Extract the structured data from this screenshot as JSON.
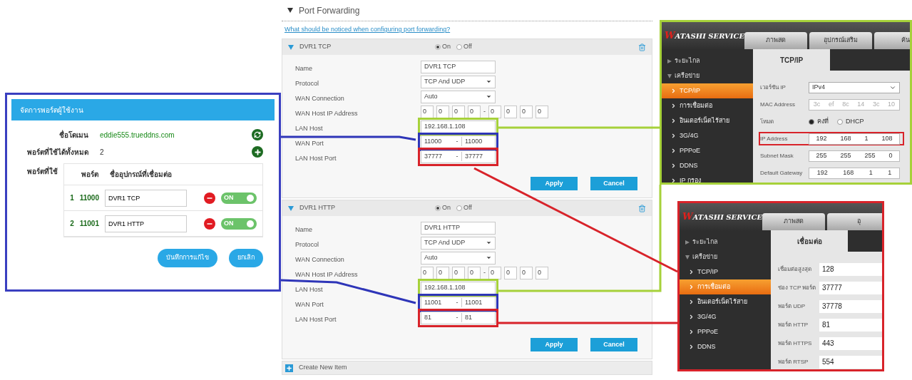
{
  "account_panel": {
    "title": "จัดการพอร์ตผู้ใช้งาน",
    "info_rows": [
      {
        "label": "ชื่อโดเมน",
        "value": "eddie555.trueddns.com",
        "kind": "refresh"
      },
      {
        "label": "พอร์ตที่ใช้ได้ทั้งหมด",
        "value": "2",
        "kind": "add"
      }
    ],
    "ports_label": "พอร์ตที่ใช้",
    "columns": [
      "พอร์ต",
      "ชื่ออุปกรณ์ที่เชื่อมต่อ"
    ],
    "rows": [
      {
        "index": "1",
        "port": "11000",
        "device": "DVR1 TCP",
        "on": true,
        "toggle_label": "ON"
      },
      {
        "index": "2",
        "port": "11001",
        "device": "DVR1 HTTP",
        "on": true,
        "toggle_label": "ON"
      }
    ],
    "buttons": [
      "บันทึกการแก้ไข",
      "ยกเลิก"
    ]
  },
  "port_forwarding": {
    "title": "Port Forwarding",
    "help_link": "What should be noticed when configuring port forwarding?",
    "rules": [
      {
        "name": "DVR1 TCP",
        "options": [
          {
            "label": "On",
            "selected": true
          },
          {
            "label": "Off",
            "selected": false
          }
        ],
        "fields": [
          {
            "kind": "text",
            "label": "Name",
            "value": "DVR1 TCP"
          },
          {
            "kind": "select",
            "label": "Protocol",
            "value": "TCP And UDP"
          },
          {
            "kind": "select",
            "label": "WAN Connection",
            "value": "Auto"
          },
          {
            "kind": "ip_range",
            "label": "WAN Host IP Address",
            "values": [
              "0",
              "0",
              "0",
              "0",
              "0",
              "0",
              "0",
              "0"
            ],
            "separator": "-"
          },
          {
            "kind": "text",
            "label": "LAN Host",
            "value": "192.168.1.108",
            "color": "#a6d13a"
          },
          {
            "kind": "range",
            "label": "WAN Port",
            "from": "11000",
            "to": "11000",
            "separator": "-",
            "color": "#2e35b8"
          },
          {
            "kind": "range",
            "label": "LAN Host Port",
            "from": "37777",
            "to": "37777",
            "separator": "-",
            "color": "#d8232a"
          }
        ],
        "buttons": [
          "Apply",
          "Cancel"
        ]
      },
      {
        "name": "DVR1 HTTP",
        "options": [
          {
            "label": "On",
            "selected": true
          },
          {
            "label": "Off",
            "selected": false
          }
        ],
        "fields": [
          {
            "kind": "text",
            "label": "Name",
            "value": "DVR1 HTTP"
          },
          {
            "kind": "select",
            "label": "Protocol",
            "value": "TCP And UDP"
          },
          {
            "kind": "select",
            "label": "WAN Connection",
            "value": "Auto"
          },
          {
            "kind": "ip_range",
            "label": "WAN Host IP Address",
            "values": [
              "0",
              "0",
              "0",
              "0",
              "0",
              "0",
              "0",
              "0"
            ],
            "separator": "-"
          },
          {
            "kind": "text",
            "label": "LAN Host",
            "value": "192.168.1.108",
            "color": "#a6d13a"
          },
          {
            "kind": "range",
            "label": "WAN Port",
            "from": "11001",
            "to": "11001",
            "separator": "-",
            "color": "#2e35b8"
          },
          {
            "kind": "range",
            "label": "LAN Host Port",
            "from": "81",
            "to": "81",
            "separator": "-",
            "color": "#d8232a"
          }
        ],
        "buttons": [
          "Apply",
          "Cancel"
        ]
      }
    ],
    "create_label": "Create New Item"
  },
  "tcpip_panel": {
    "brand_initial": "W",
    "brand_rest": "ATASHI SERVICE",
    "tabs": [
      "ภาพสด",
      "อุปกรณ์เสริม",
      "ค้น"
    ],
    "sidebar": [
      {
        "kind": "group",
        "label": "ระยะไกล",
        "expanded": false,
        "selected": false
      },
      {
        "kind": "group",
        "label": "เครือข่าย",
        "expanded": true,
        "selected": false
      },
      {
        "kind": "item",
        "label": "TCP/IP",
        "selected": true
      },
      {
        "kind": "item",
        "label": "การเชื่อมต่อ",
        "selected": false
      },
      {
        "kind": "item",
        "label": "อินเตอร์เน็ตไร้สาย",
        "selected": false
      },
      {
        "kind": "item",
        "label": "3G/4G",
        "selected": false
      },
      {
        "kind": "item",
        "label": "PPPoE",
        "selected": false
      },
      {
        "kind": "item",
        "label": "DDNS",
        "selected": false
      },
      {
        "kind": "item",
        "label": "IP กรอง",
        "selected": false
      }
    ],
    "page_tab": "TCP/IP",
    "fields": [
      {
        "kind": "select",
        "label": "เวอร์ชัน IP",
        "value": "IPv4"
      },
      {
        "kind": "mac",
        "label": "MAC Address",
        "values": [
          "3c",
          "ef",
          "8c",
          "14",
          "3c",
          "10"
        ]
      },
      {
        "kind": "radio",
        "label": "โหมด",
        "options": [
          {
            "label": "คงที่",
            "selected": true
          },
          {
            "label": "DHCP",
            "selected": false
          }
        ]
      },
      {
        "kind": "ip",
        "label": "IP Address",
        "values": [
          "192",
          "168",
          "1",
          "108"
        ],
        "color": "#d8232a"
      },
      {
        "kind": "ip",
        "label": "Subnet Mask",
        "values": [
          "255",
          "255",
          "255",
          "0"
        ]
      },
      {
        "kind": "ip",
        "label": "Default Gateway",
        "values": [
          "192",
          "168",
          "1",
          "1"
        ]
      }
    ]
  },
  "connection_panel": {
    "brand_initial": "W",
    "brand_rest": "ATASHI SERVICE",
    "tabs": [
      "ภาพสด",
      "อุ"
    ],
    "sidebar": [
      {
        "kind": "group",
        "label": "ระยะไกล",
        "expanded": false,
        "selected": false
      },
      {
        "kind": "group",
        "label": "เครือข่าย",
        "expanded": true,
        "selected": false
      },
      {
        "kind": "item",
        "label": "TCP/IP",
        "selected": false
      },
      {
        "kind": "item",
        "label": "การเชื่อมต่อ",
        "selected": true
      },
      {
        "kind": "item",
        "label": "อินเตอร์เน็ตไร้สาย",
        "selected": false
      },
      {
        "kind": "item",
        "label": "3G/4G",
        "selected": false
      },
      {
        "kind": "item",
        "label": "PPPoE",
        "selected": false
      },
      {
        "kind": "item",
        "label": "DDNS",
        "selected": false
      }
    ],
    "page_tab": "เชื่อมต่อ",
    "fields": [
      {
        "kind": "text",
        "label": "เชื่อมต่อสูงสุด",
        "value": "128"
      },
      {
        "kind": "text",
        "label": "ช่อง TCP พอร์ต",
        "value": "37777"
      },
      {
        "kind": "text",
        "label": "พอร์ต UDP",
        "value": "37778"
      },
      {
        "kind": "text",
        "label": "พอร์ต HTTP",
        "value": "81"
      },
      {
        "kind": "text",
        "label": "พอร์ต HTTPS",
        "value": "443"
      },
      {
        "kind": "text",
        "label": "พอร์ต RTSP",
        "value": "554"
      }
    ]
  }
}
